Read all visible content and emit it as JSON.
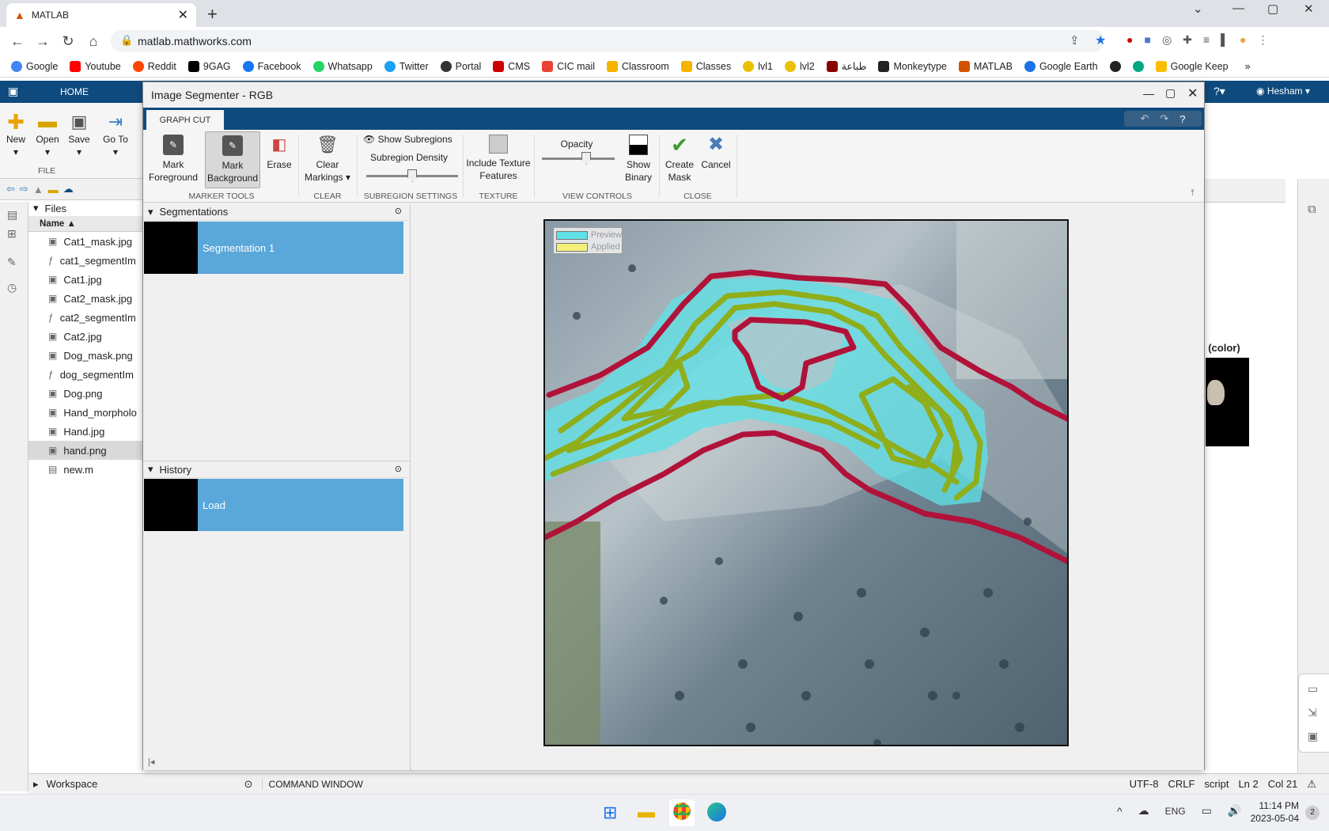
{
  "browser": {
    "tab_title": "MATLAB",
    "url": "matlab.mathworks.com",
    "bookmarks": [
      "Google",
      "Youtube",
      "Reddit",
      "9GAG",
      "Facebook",
      "Whatsapp",
      "Twitter",
      "Portal",
      "CMS",
      "CIC mail",
      "Classroom",
      "Classes",
      "lvl1",
      "lvl2",
      "طباعة",
      "Monkeytype",
      "MATLAB",
      "Google Earth",
      "",
      "",
      "Google Keep"
    ],
    "bookmark_colors": [
      "#4285f4",
      "#ff0000",
      "#ff4500",
      "#000000",
      "#1877f2",
      "#25d366",
      "#1da1f2",
      "#333333",
      "#cc0000",
      "#ea4335",
      "#f4b400",
      "#f4b400",
      "#e8c200",
      "#e8c200",
      "#8b0000",
      "#222222",
      "#d35400",
      "#1a73e8",
      "#222222",
      "#00a884",
      "#fbbc04"
    ]
  },
  "matlab": {
    "home_tab": "HOME",
    "user": "Hesham",
    "toolstrip": {
      "new": "New",
      "open": "Open",
      "save": "Save",
      "goto": "Go To",
      "file_section": "FILE"
    },
    "files_header": "Files",
    "name_col": "Name",
    "files": [
      "Cat1_mask.jpg",
      "cat1_segmentIm",
      "Cat1.jpg",
      "Cat2_mask.jpg",
      "cat2_segmentIm",
      "Cat2.jpg",
      "Dog_mask.png",
      "dog_segmentIm",
      "Dog.png",
      "Hand_morpholo",
      "Hand.jpg",
      "hand.png",
      "new.m"
    ],
    "selected_file_index": 11,
    "right_label": "l (color)",
    "workspace": "Workspace",
    "command_window": "COMMAND WINDOW",
    "status": {
      "encoding": "UTF-8",
      "eol": "CRLF",
      "type": "script",
      "ln": "Ln 2",
      "col": "Col 21"
    }
  },
  "segmenter": {
    "title": "Image Segmenter - RGB",
    "tab": "GRAPH CUT",
    "buttons": {
      "mark_fg_1": "Mark",
      "mark_fg_2": "Foreground",
      "mark_bg_1": "Mark",
      "mark_bg_2": "Background",
      "erase": "Erase",
      "clear_1": "Clear",
      "clear_2": "Markings",
      "show_subregions": "Show Subregions",
      "subregion_density": "Subregion Density",
      "texture_1": "Include Texture",
      "texture_2": "Features",
      "opacity": "Opacity",
      "show_binary_1": "Show",
      "show_binary_2": "Binary",
      "create_1": "Create",
      "create_2": "Mask",
      "cancel": "Cancel"
    },
    "sections": {
      "marker": "MARKER TOOLS",
      "clear": "CLEAR",
      "subregion": "SUBREGION SETTINGS",
      "texture": "TEXTURE",
      "view": "VIEW CONTROLS",
      "close": "CLOSE"
    },
    "segmentations_header": "Segmentations",
    "segmentation_item": "Segmentation 1",
    "history_header": "History",
    "history_item": "Load",
    "legend": {
      "preview": "Preview",
      "applied": "Applied"
    },
    "colors": {
      "preview": "#5fe0e6",
      "applied": "#f5f07a",
      "foreground": "#8fae1b",
      "background": "#b0123a",
      "selection": "#5aa7da"
    }
  },
  "taskbar": {
    "lang": "ENG",
    "time": "11:14 PM",
    "date": "2023-05-04",
    "badge": "2"
  }
}
